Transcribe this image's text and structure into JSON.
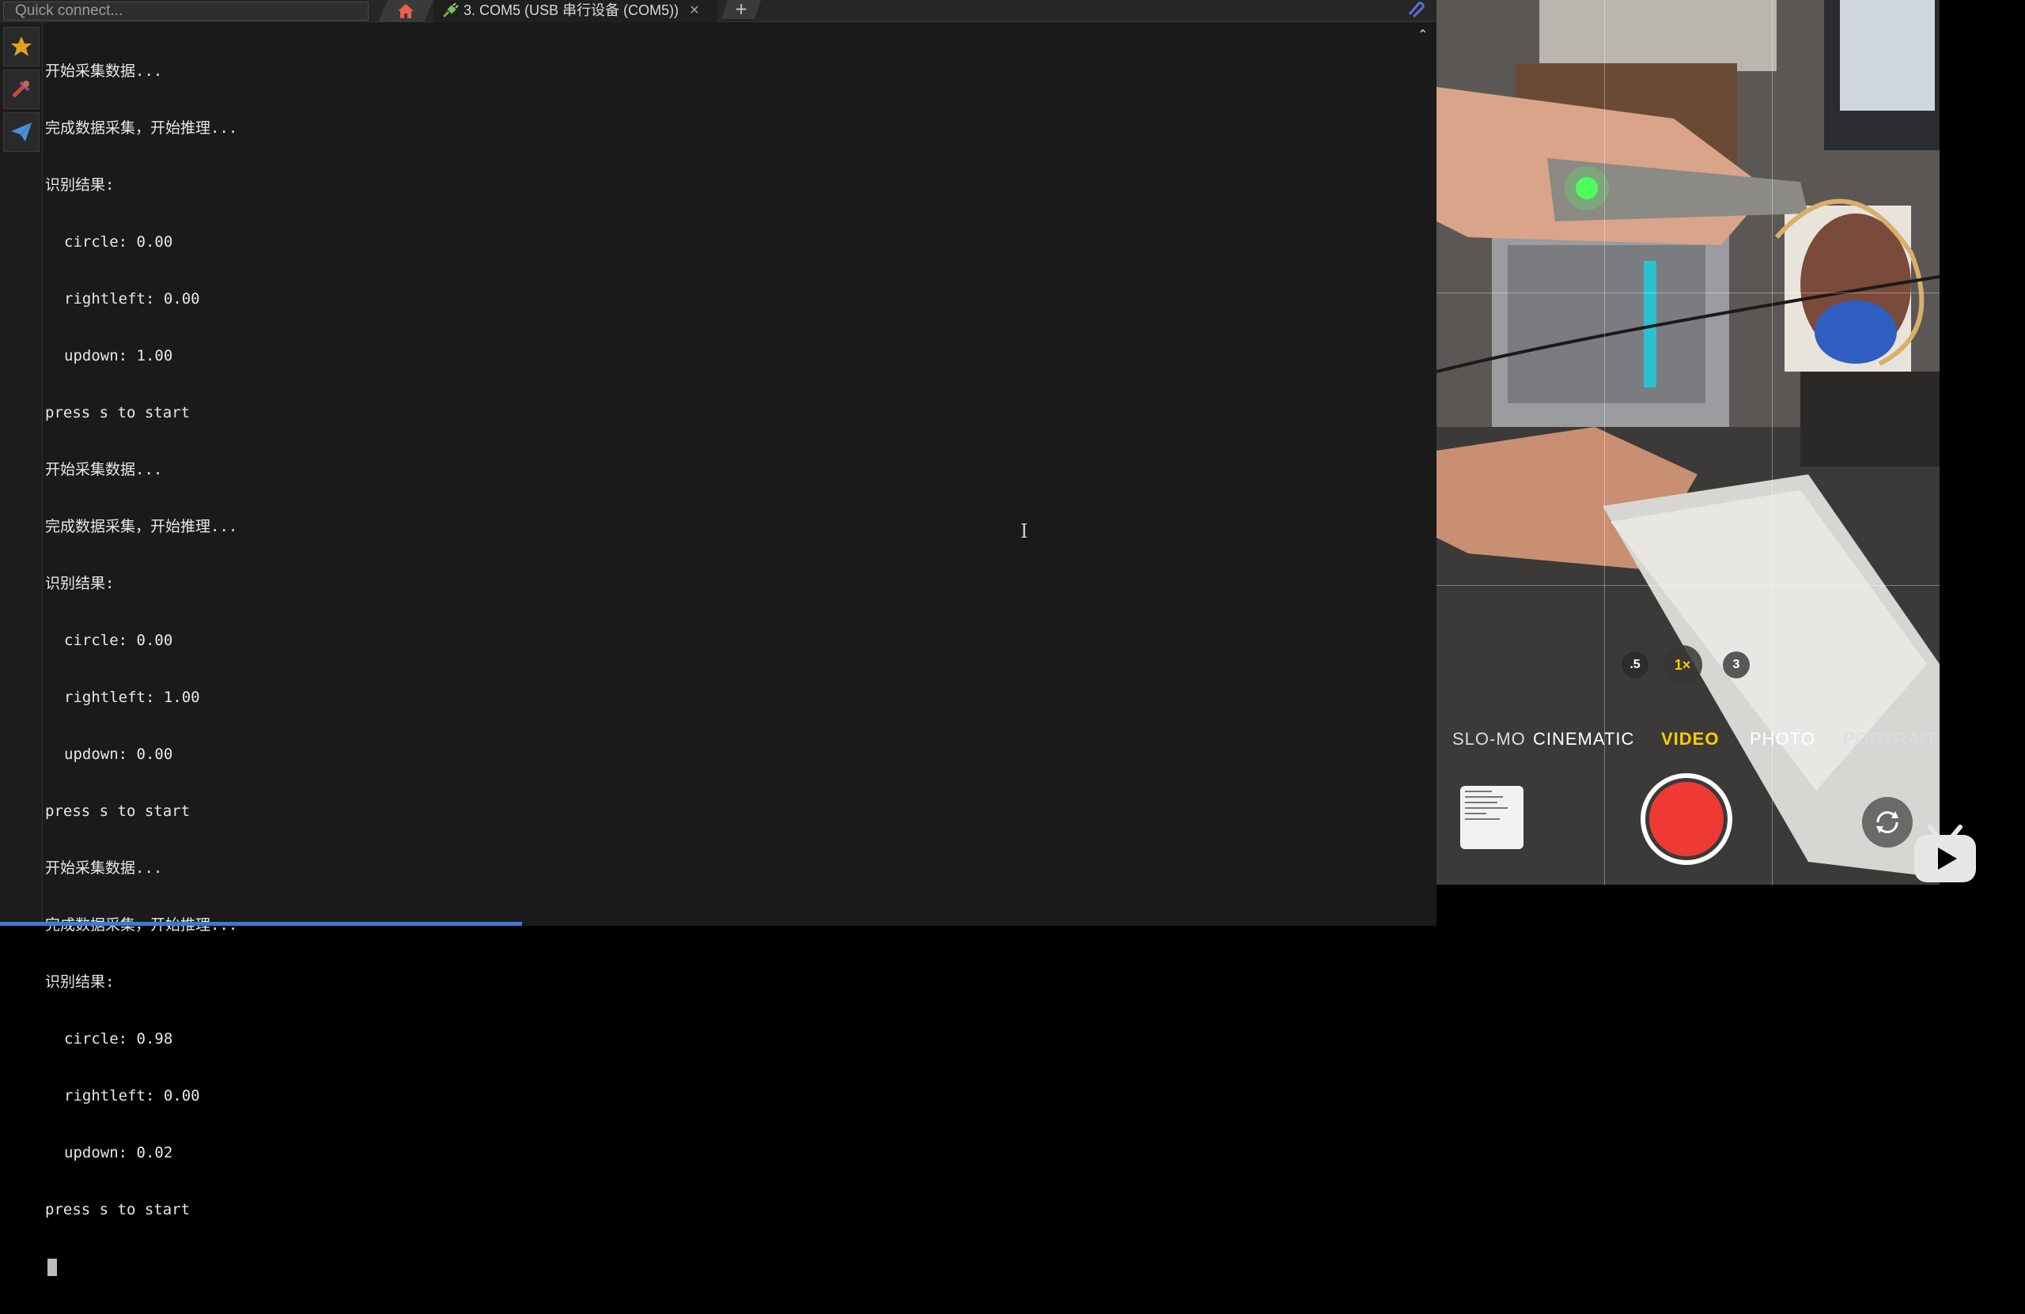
{
  "colors": {
    "terminal_bg": "#1a1a1a",
    "terminal_text": "#e8e8e8",
    "record_red": "#ee3a33",
    "video_mode_yellow": "#ffcc00",
    "accent_blue": "#3a7bd5"
  },
  "toolbar": {
    "quick_connect_placeholder": "Quick connect...",
    "home_icon": "home-icon",
    "session_tab": {
      "icon": "plug-icon",
      "label": "3. COM5  (USB 串行设备 (COM5))",
      "close": "×"
    },
    "new_tab": "+",
    "right_icon": "paperclip-icon"
  },
  "sidebar": {
    "items": [
      {
        "icon": "star-icon"
      },
      {
        "icon": "tools-icon"
      },
      {
        "icon": "send-icon"
      }
    ]
  },
  "console": {
    "lines": [
      {
        "text": "开始采集数据...",
        "indent": false
      },
      {
        "text": "完成数据采集，开始推理...",
        "indent": false
      },
      {
        "text": "识别结果:",
        "indent": false
      },
      {
        "text": "circle: 0.00",
        "indent": true
      },
      {
        "text": "rightleft: 0.00",
        "indent": true
      },
      {
        "text": "updown: 1.00",
        "indent": true
      },
      {
        "text": "press s to start",
        "indent": false
      },
      {
        "text": "开始采集数据...",
        "indent": false
      },
      {
        "text": "完成数据采集，开始推理...",
        "indent": false
      },
      {
        "text": "识别结果:",
        "indent": false
      },
      {
        "text": "circle: 0.00",
        "indent": true
      },
      {
        "text": "rightleft: 1.00",
        "indent": true
      },
      {
        "text": "updown: 0.00",
        "indent": true
      },
      {
        "text": "press s to start",
        "indent": false
      },
      {
        "text": "开始采集数据...",
        "indent": false
      },
      {
        "text": "完成数据采集，开始推理...",
        "indent": false
      },
      {
        "text": "识别结果:",
        "indent": false
      },
      {
        "text": "circle: 0.98",
        "indent": true
      },
      {
        "text": "rightleft: 0.00",
        "indent": true
      },
      {
        "text": "updown: 0.02",
        "indent": true
      },
      {
        "text": "press s to start",
        "indent": false
      }
    ]
  },
  "camera": {
    "zoom_options": [
      ".5",
      "1×",
      "3"
    ],
    "selected_zoom": "1×",
    "modes": [
      "SLO-MO",
      "CINEMATIC",
      "VIDEO",
      "PHOTO",
      "PORTRAIT"
    ],
    "selected_mode": "VIDEO",
    "flip_icon": "camera-flip-icon",
    "record_icon": "record-button"
  },
  "watermark": {
    "icon": "bilibili-logo"
  }
}
